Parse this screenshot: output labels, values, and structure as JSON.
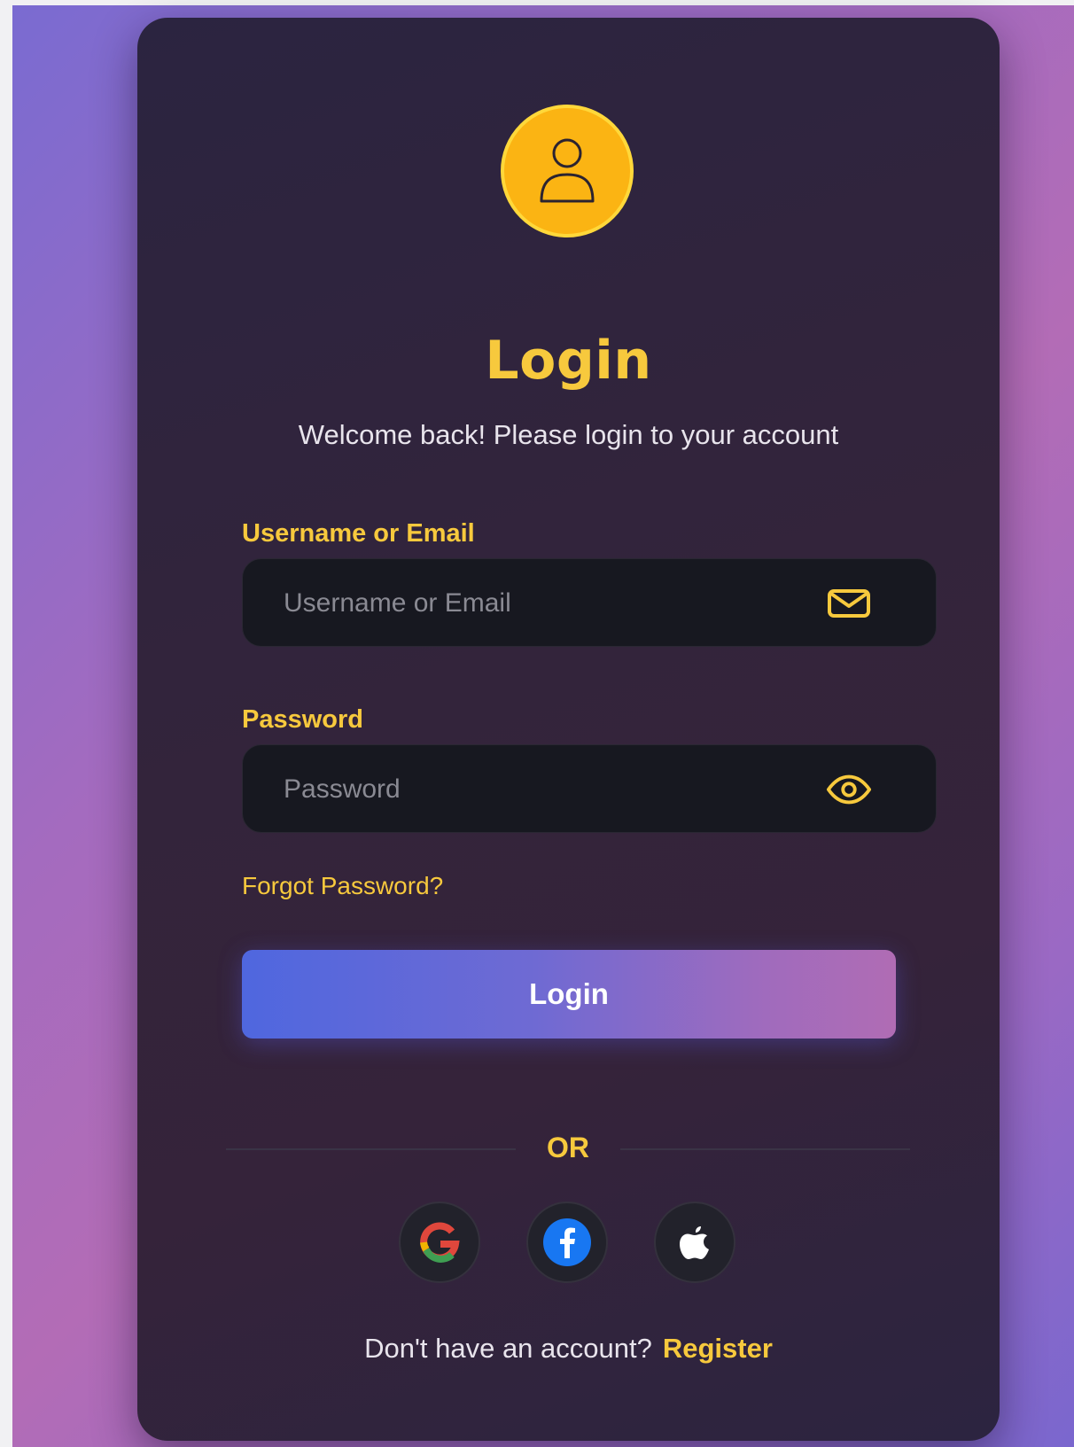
{
  "header": {
    "title": "Login",
    "subtitle": "Welcome back! Please login to your account"
  },
  "form": {
    "username": {
      "label": "Username or Email",
      "placeholder": "Username or Email",
      "value": "",
      "icon": "mail-icon"
    },
    "password": {
      "label": "Password",
      "placeholder": "Password",
      "value": "",
      "icon": "eye-icon"
    },
    "forgot_label": "Forgot Password?",
    "submit_label": "Login"
  },
  "divider": {
    "label": "OR"
  },
  "social": [
    {
      "name": "google",
      "icon": "google-icon"
    },
    {
      "name": "facebook",
      "icon": "facebook-icon"
    },
    {
      "name": "apple",
      "icon": "apple-icon"
    }
  ],
  "footer": {
    "prompt": "Don't have an account?",
    "register_label": "Register"
  },
  "colors": {
    "accent": "#f7c93d",
    "avatar_bg": "#fbb413",
    "card_bg": "#2f2440",
    "input_bg": "#171820"
  }
}
